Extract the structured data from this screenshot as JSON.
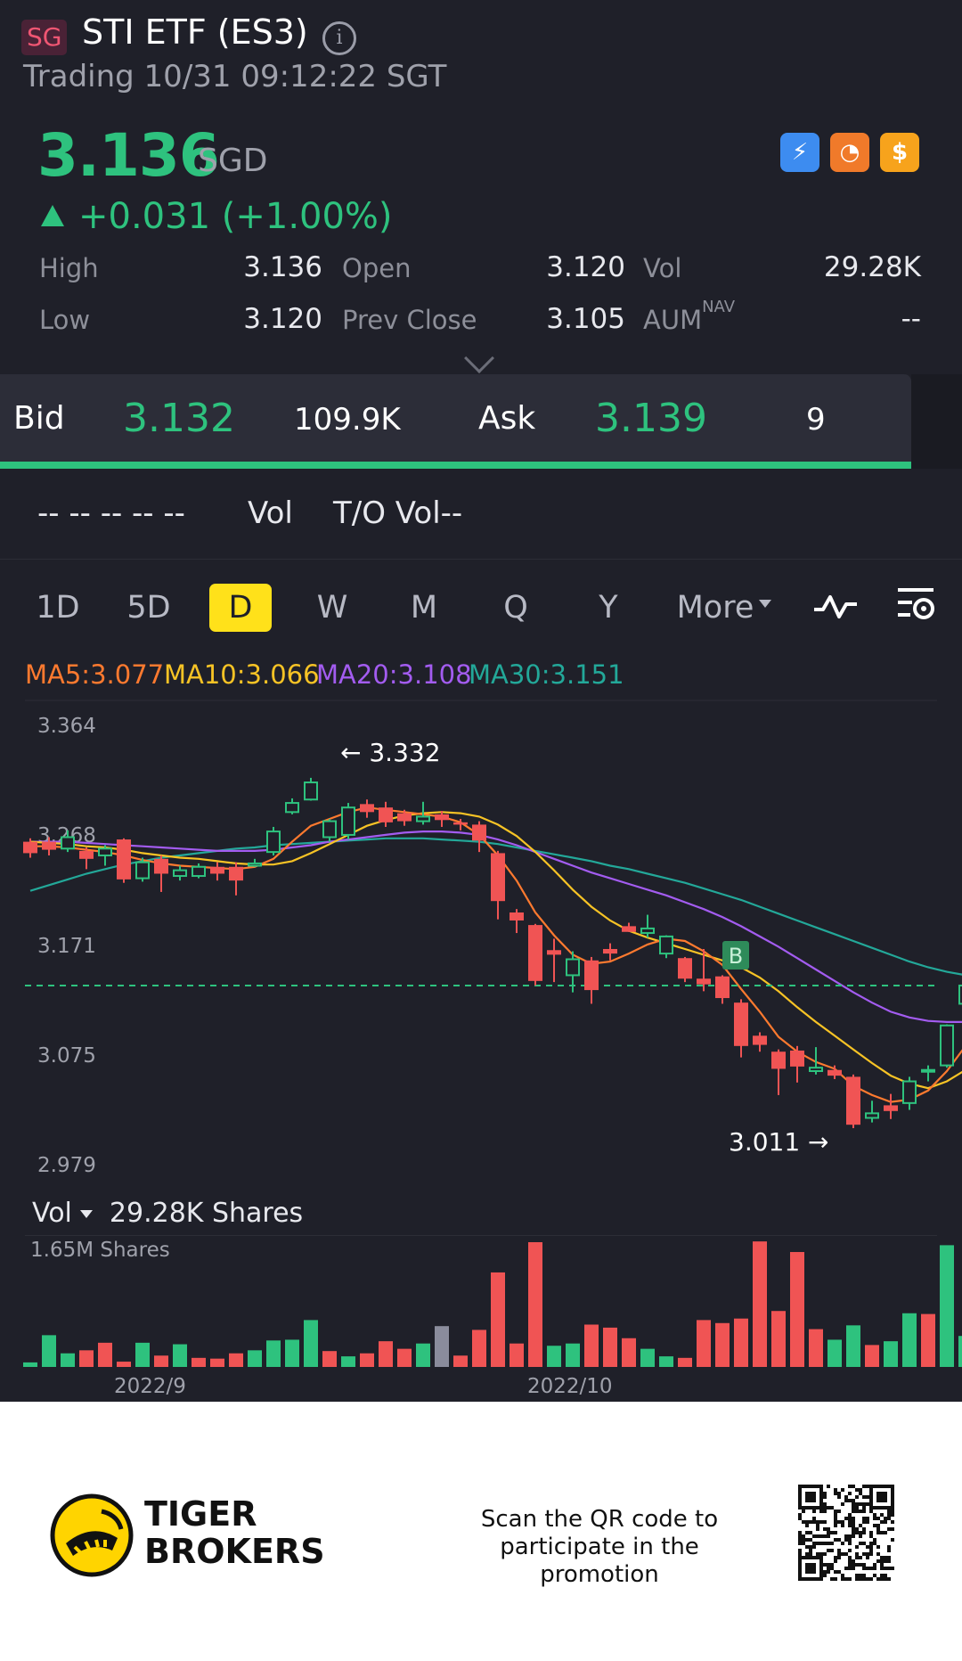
{
  "header": {
    "market_badge": "SG",
    "title": "STI ETF (ES3)",
    "status": "Trading 10/31 09:12:22 SGT"
  },
  "quote": {
    "price": "3.136",
    "currency": "SGD",
    "change": "+0.031 (+1.00%)"
  },
  "stats": {
    "high_label": "High",
    "high": "3.136",
    "low_label": "Low",
    "low": "3.120",
    "open_label": "Open",
    "open": "3.120",
    "prev_close_label": "Prev Close",
    "prev_close": "3.105",
    "vol_label": "Vol",
    "vol": "29.28K",
    "aum_label": "AUM",
    "aum_sup": "NAV",
    "aum": "--"
  },
  "bid_ask": {
    "bid_label": "Bid",
    "bid": "3.132",
    "bid_size": "109.9K",
    "ask_label": "Ask",
    "ask": "3.139",
    "ask_size": "9"
  },
  "vol_row": {
    "dashes": "-- -- -- -- --",
    "vol_label": "Vol",
    "to_vol": "T/O Vol--"
  },
  "tabs": [
    "1D",
    "5D",
    "D",
    "W",
    "M",
    "Q",
    "Y"
  ],
  "tabs_active": "D",
  "more_label": "More",
  "ma": {
    "ma5": "MA5:3.077",
    "ma10": "MA10:3.066",
    "ma20": "MA20:3.108",
    "ma30": "MA30:3.151"
  },
  "colors": {
    "up": "#2ec27e",
    "down": "#f05454",
    "accent": "#ffe11a",
    "ma5": "#ff7a2f",
    "ma10": "#f7c325",
    "ma20": "#a35cf0",
    "ma30": "#23a899"
  },
  "chart_data": {
    "type": "candlestick",
    "y_ticks": [
      "3.364",
      "3.268",
      "3.171",
      "3.075",
      "2.979"
    ],
    "ylim": [
      2.979,
      3.364
    ],
    "high_marker": "3.332",
    "low_marker": "3.011",
    "buy_marker": "B",
    "current_price": 3.136,
    "candles": [
      {
        "o": 3.262,
        "c": 3.252,
        "h": 3.265,
        "l": 3.248
      },
      {
        "o": 3.262,
        "c": 3.255,
        "h": 3.266,
        "l": 3.25
      },
      {
        "o": 3.256,
        "c": 3.266,
        "h": 3.272,
        "l": 3.253
      },
      {
        "o": 3.254,
        "c": 3.247,
        "h": 3.257,
        "l": 3.238
      },
      {
        "o": 3.25,
        "c": 3.256,
        "h": 3.259,
        "l": 3.241
      },
      {
        "o": 3.264,
        "c": 3.229,
        "h": 3.265,
        "l": 3.226
      },
      {
        "o": 3.23,
        "c": 3.244,
        "h": 3.248,
        "l": 3.227
      },
      {
        "o": 3.247,
        "c": 3.234,
        "h": 3.25,
        "l": 3.218
      },
      {
        "o": 3.232,
        "c": 3.237,
        "h": 3.241,
        "l": 3.228
      },
      {
        "o": 3.232,
        "c": 3.24,
        "h": 3.243,
        "l": 3.23
      },
      {
        "o": 3.24,
        "c": 3.234,
        "h": 3.244,
        "l": 3.228
      },
      {
        "o": 3.24,
        "c": 3.228,
        "h": 3.244,
        "l": 3.215
      },
      {
        "o": 3.241,
        "c": 3.243,
        "h": 3.247,
        "l": 3.24
      },
      {
        "o": 3.253,
        "c": 3.271,
        "h": 3.275,
        "l": 3.25
      },
      {
        "o": 3.288,
        "c": 3.296,
        "h": 3.3,
        "l": 3.286
      },
      {
        "o": 3.299,
        "c": 3.314,
        "h": 3.318,
        "l": 3.298
      },
      {
        "o": 3.266,
        "c": 3.28,
        "h": 3.282,
        "l": 3.262
      },
      {
        "o": 3.268,
        "c": 3.292,
        "h": 3.296,
        "l": 3.264
      },
      {
        "o": 3.295,
        "c": 3.288,
        "h": 3.299,
        "l": 3.283
      },
      {
        "o": 3.292,
        "c": 3.279,
        "h": 3.297,
        "l": 3.275
      },
      {
        "o": 3.287,
        "c": 3.28,
        "h": 3.29,
        "l": 3.276
      },
      {
        "o": 3.28,
        "c": 3.284,
        "h": 3.297,
        "l": 3.277
      },
      {
        "o": 3.286,
        "c": 3.281,
        "h": 3.289,
        "l": 3.275
      },
      {
        "o": 3.279,
        "c": 3.277,
        "h": 3.282,
        "l": 3.272
      },
      {
        "o": 3.277,
        "c": 3.263,
        "h": 3.28,
        "l": 3.253
      },
      {
        "o": 3.252,
        "c": 3.21,
        "h": 3.254,
        "l": 3.194
      },
      {
        "o": 3.2,
        "c": 3.193,
        "h": 3.203,
        "l": 3.182
      },
      {
        "o": 3.189,
        "c": 3.14,
        "h": 3.19,
        "l": 3.136
      },
      {
        "o": 3.167,
        "c": 3.163,
        "h": 3.177,
        "l": 3.139
      },
      {
        "o": 3.145,
        "c": 3.159,
        "h": 3.166,
        "l": 3.13
      },
      {
        "o": 3.158,
        "c": 3.132,
        "h": 3.161,
        "l": 3.12
      },
      {
        "o": 3.168,
        "c": 3.164,
        "h": 3.173,
        "l": 3.158
      },
      {
        "o": 3.188,
        "c": 3.183,
        "h": 3.191,
        "l": 3.183
      },
      {
        "o": 3.182,
        "c": 3.186,
        "h": 3.198,
        "l": 3.178
      },
      {
        "o": 3.164,
        "c": 3.179,
        "h": 3.18,
        "l": 3.16
      },
      {
        "o": 3.16,
        "c": 3.142,
        "h": 3.161,
        "l": 3.139
      },
      {
        "o": 3.142,
        "c": 3.137,
        "h": 3.168,
        "l": 3.131
      },
      {
        "o": 3.144,
        "c": 3.125,
        "h": 3.145,
        "l": 3.12
      },
      {
        "o": 3.121,
        "c": 3.083,
        "h": 3.124,
        "l": 3.073
      },
      {
        "o": 3.092,
        "c": 3.084,
        "h": 3.095,
        "l": 3.078
      },
      {
        "o": 3.078,
        "c": 3.063,
        "h": 3.08,
        "l": 3.04
      },
      {
        "o": 3.079,
        "c": 3.065,
        "h": 3.083,
        "l": 3.051
      },
      {
        "o": 3.061,
        "c": 3.064,
        "h": 3.082,
        "l": 3.058
      },
      {
        "o": 3.062,
        "c": 3.057,
        "h": 3.066,
        "l": 3.054
      },
      {
        "o": 3.056,
        "c": 3.014,
        "h": 3.058,
        "l": 3.011
      },
      {
        "o": 3.02,
        "c": 3.024,
        "h": 3.035,
        "l": 3.016
      },
      {
        "o": 3.031,
        "c": 3.026,
        "h": 3.041,
        "l": 3.019
      },
      {
        "o": 3.033,
        "c": 3.052,
        "h": 3.056,
        "l": 3.027
      },
      {
        "o": 3.061,
        "c": 3.062,
        "h": 3.066,
        "l": 3.052
      },
      {
        "o": 3.066,
        "c": 3.101,
        "h": 3.102,
        "l": 3.064
      },
      {
        "o": 3.12,
        "c": 3.136,
        "h": 3.136,
        "l": 3.12
      }
    ],
    "ma5": [
      3.258,
      3.258,
      3.257,
      3.255,
      3.253,
      3.25,
      3.246,
      3.243,
      3.241,
      3.24,
      3.239,
      3.238,
      3.24,
      3.247,
      3.262,
      3.276,
      3.282,
      3.288,
      3.292,
      3.29,
      3.288,
      3.286,
      3.284,
      3.279,
      3.268,
      3.25,
      3.228,
      3.2,
      3.18,
      3.163,
      3.155,
      3.157,
      3.164,
      3.172,
      3.177,
      3.175,
      3.166,
      3.154,
      3.133,
      3.113,
      3.091,
      3.078,
      3.069,
      3.063,
      3.048,
      3.04,
      3.034,
      3.036,
      3.044,
      3.061,
      3.083
    ],
    "ma10": [
      3.262,
      3.261,
      3.26,
      3.258,
      3.257,
      3.255,
      3.252,
      3.25,
      3.248,
      3.247,
      3.245,
      3.243,
      3.242,
      3.242,
      3.245,
      3.252,
      3.26,
      3.268,
      3.276,
      3.281,
      3.285,
      3.287,
      3.288,
      3.287,
      3.284,
      3.277,
      3.267,
      3.253,
      3.237,
      3.22,
      3.205,
      3.193,
      3.184,
      3.178,
      3.173,
      3.168,
      3.163,
      3.158,
      3.152,
      3.143,
      3.131,
      3.117,
      3.104,
      3.092,
      3.08,
      3.068,
      3.057,
      3.05,
      3.046,
      3.052,
      3.062
    ],
    "ma20": [
      3.262,
      3.262,
      3.262,
      3.261,
      3.26,
      3.259,
      3.258,
      3.257,
      3.256,
      3.255,
      3.254,
      3.254,
      3.254,
      3.255,
      3.257,
      3.259,
      3.262,
      3.264,
      3.266,
      3.268,
      3.27,
      3.271,
      3.271,
      3.27,
      3.268,
      3.264,
      3.259,
      3.253,
      3.247,
      3.241,
      3.235,
      3.23,
      3.225,
      3.22,
      3.215,
      3.209,
      3.203,
      3.196,
      3.188,
      3.179,
      3.17,
      3.16,
      3.15,
      3.14,
      3.13,
      3.121,
      3.113,
      3.108,
      3.105,
      3.104,
      3.104
    ],
    "ma30": [
      3.219,
      3.224,
      3.229,
      3.234,
      3.238,
      3.242,
      3.245,
      3.248,
      3.25,
      3.252,
      3.254,
      3.256,
      3.257,
      3.259,
      3.26,
      3.261,
      3.262,
      3.263,
      3.264,
      3.265,
      3.265,
      3.265,
      3.264,
      3.263,
      3.262,
      3.26,
      3.257,
      3.254,
      3.251,
      3.248,
      3.245,
      3.241,
      3.238,
      3.234,
      3.23,
      3.226,
      3.221,
      3.216,
      3.211,
      3.205,
      3.199,
      3.193,
      3.187,
      3.181,
      3.175,
      3.169,
      3.163,
      3.157,
      3.152,
      3.148,
      3.145
    ],
    "volume": {
      "label": "Vol",
      "current": "29.28K Shares",
      "max_label": "1.65M Shares",
      "max": 1.65,
      "bars": [
        0.06,
        0.42,
        0.18,
        0.22,
        0.32,
        0.07,
        0.32,
        0.15,
        0.3,
        0.12,
        0.11,
        0.18,
        0.22,
        0.35,
        0.36,
        0.62,
        0.21,
        0.14,
        0.18,
        0.34,
        0.24,
        0.31,
        0.54,
        0.15,
        0.49,
        1.25,
        0.31,
        1.65,
        0.28,
        0.31,
        0.56,
        0.52,
        0.38,
        0.24,
        0.14,
        0.12,
        0.62,
        0.58,
        0.64,
        1.66,
        0.74,
        1.52,
        0.5,
        0.36,
        0.55,
        0.29,
        0.34,
        0.71,
        0.7,
        1.61,
        0.41
      ],
      "up": [
        true,
        true,
        true,
        false,
        false,
        false,
        true,
        false,
        true,
        false,
        false,
        false,
        true,
        true,
        true,
        true,
        false,
        true,
        false,
        false,
        false,
        true,
        "neutral",
        false,
        false,
        false,
        false,
        false,
        true,
        true,
        false,
        false,
        false,
        true,
        true,
        false,
        false,
        false,
        false,
        false,
        false,
        false,
        false,
        true,
        true,
        false,
        true,
        true,
        false,
        true,
        true
      ]
    },
    "x_dates": [
      "2022/9",
      "2022/10"
    ]
  },
  "footer": {
    "brand_line1": "TIGER",
    "brand_line2": "BROKERS",
    "promo": "Scan the QR code to participate in the promotion"
  }
}
